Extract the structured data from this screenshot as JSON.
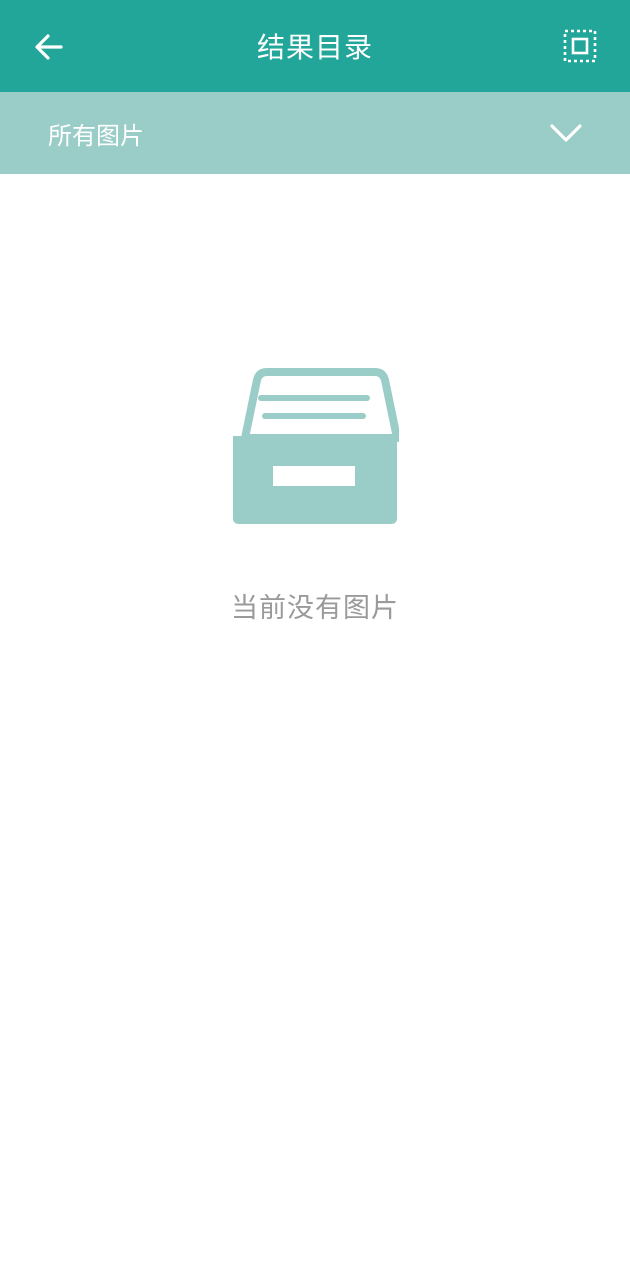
{
  "header": {
    "title": "结果目录",
    "back_icon": "arrow-left-icon",
    "select_icon": "select-frame-icon"
  },
  "filter": {
    "label": "所有图片",
    "icon": "chevron-down-icon"
  },
  "empty_state": {
    "icon": "archive-box-icon",
    "message": "当前没有图片"
  },
  "colors": {
    "header_bg": "#22a69a",
    "filter_bg": "#9bcdc8",
    "icon_fill": "#9bcdc8",
    "empty_text": "#9a9a9a"
  }
}
